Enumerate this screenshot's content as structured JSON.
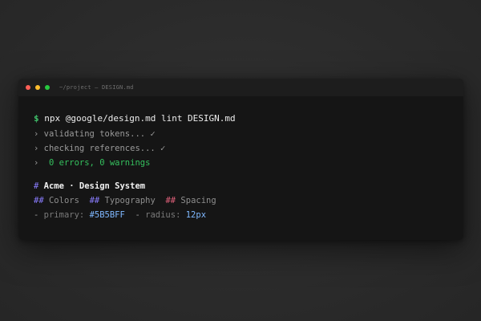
{
  "window": {
    "title": "~/project — DESIGN.md",
    "colors": {
      "close": "#ff5f56",
      "minimize": "#ffbd2e",
      "maximize": "#27c93f"
    }
  },
  "terminal": {
    "prompt": "$",
    "command": "npx @google/design.md lint DESIGN.md",
    "output": [
      {
        "marker": "›",
        "text": "validating tokens... ✓"
      },
      {
        "marker": "›",
        "text": "checking references... ✓"
      },
      {
        "marker": "›",
        "text": " 0 errors, 0 warnings"
      }
    ],
    "heading_marker": "#",
    "heading": "Acme · Design System",
    "sections": [
      {
        "marker": "##",
        "label": "Colors"
      },
      {
        "marker": "##",
        "label": "Typography"
      },
      {
        "marker": "##",
        "label": "Spacing"
      }
    ],
    "tokens": [
      {
        "bullet": "-",
        "key": "primary:",
        "value": "#5B5BFF"
      },
      {
        "bullet": "-",
        "key": "radius:",
        "value": "12px"
      }
    ]
  }
}
